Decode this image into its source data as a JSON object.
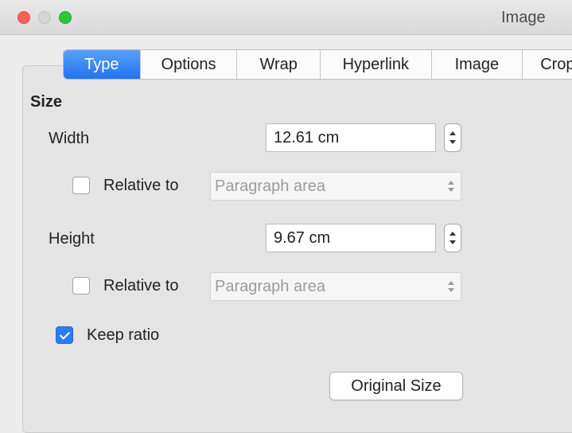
{
  "window": {
    "title": "Image"
  },
  "tabs": [
    {
      "label": "Type",
      "active": true
    },
    {
      "label": "Options",
      "active": false
    },
    {
      "label": "Wrap",
      "active": false
    },
    {
      "label": "Hyperlink",
      "active": false
    },
    {
      "label": "Image",
      "active": false
    },
    {
      "label": "Crop",
      "active": false
    }
  ],
  "size": {
    "title": "Size",
    "width": {
      "label": "Width",
      "value": "12.61 cm",
      "relative_label": "Relative to",
      "relative_checked": false,
      "relative_option": "Paragraph area"
    },
    "height": {
      "label": "Height",
      "value": "9.67 cm",
      "relative_label": "Relative to",
      "relative_checked": false,
      "relative_option": "Paragraph area"
    },
    "keep_ratio": {
      "label": "Keep ratio",
      "checked": true
    },
    "original_size_label": "Original Size"
  },
  "colors": {
    "accent": "#2a7df4",
    "close": "#fc5f57",
    "maximize": "#2ac840"
  },
  "icons": {
    "stepper": "up-down-stepper-icon",
    "select": "chevron-updown-icon",
    "check": "checkmark-icon"
  }
}
